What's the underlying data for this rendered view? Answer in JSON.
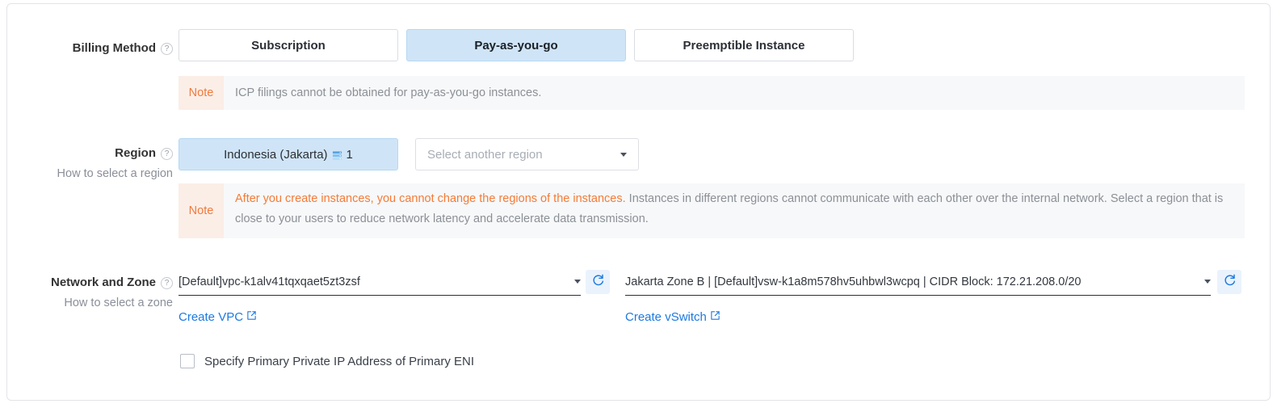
{
  "form": {
    "billing": {
      "label": "Billing Method",
      "help_icon": "question-circle-icon",
      "options": [
        {
          "label": "Subscription",
          "selected": false
        },
        {
          "label": "Pay-as-you-go",
          "selected": true
        },
        {
          "label": "Preemptible Instance",
          "selected": false
        }
      ],
      "note": {
        "badge": "Note",
        "text": "ICP filings cannot be obtained for pay-as-you-go instances."
      }
    },
    "region": {
      "label": "Region",
      "help_icon": "question-circle-icon",
      "sub_label": "How to select a region",
      "selected_region": "Indonesia (Jakarta)",
      "selected_region_count": "1",
      "region_icon": "server-stack-icon",
      "select_placeholder": "Select another region",
      "caret_icon": "chevron-down-icon",
      "note": {
        "badge": "Note",
        "highlight": "After you create instances, you cannot change the regions of the instances.",
        "text": " Instances in different regions cannot communicate with each other over the internal network. Select a region that is close to your users to reduce network latency and accelerate data transmission."
      }
    },
    "network": {
      "label": "Network and Zone",
      "help_icon": "question-circle-icon",
      "sub_label": "How to select a zone",
      "vpc_value": "[Default]vpc-k1alv41tqxqaet5zt3zsf",
      "vswitch_value": "Jakarta Zone B | [Default]vsw-k1a8m578hv5uhbwl3wcpq | CIDR Block: 172.21.208.0/20",
      "refresh_icon": "refresh-icon",
      "caret_icon": "chevron-down-icon",
      "create_vpc_link": "Create VPC",
      "create_vswitch_link": "Create vSwitch",
      "external_link_icon": "external-link-icon",
      "checkbox": {
        "label": "Specify Primary Private IP Address of Primary ENI",
        "checked": false
      }
    }
  },
  "colors": {
    "accent_blue": "#1d7ae0",
    "selected_fill": "#cfe5f7",
    "note_orange": "#f47b38",
    "note_badge_bg": "#fbeee7",
    "note_bg": "#f7f8f9"
  }
}
